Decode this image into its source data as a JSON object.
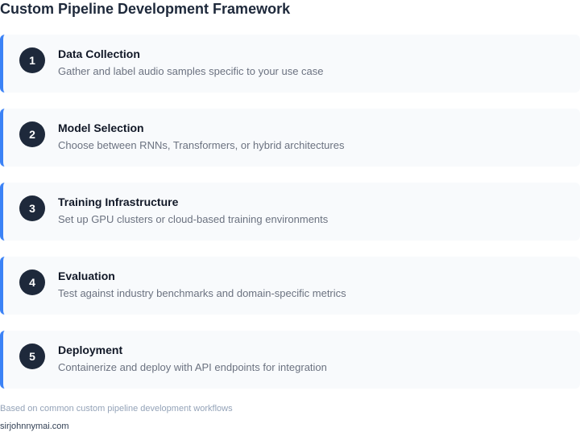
{
  "page": {
    "title": "Custom Pipeline Development Framework"
  },
  "steps": [
    {
      "number": "1",
      "title": "Data Collection",
      "description": "Gather and label audio samples specific to your use case"
    },
    {
      "number": "2",
      "title": "Model Selection",
      "description": "Choose between RNNs, Transformers, or hybrid architectures"
    },
    {
      "number": "3",
      "title": "Training Infrastructure",
      "description": "Set up GPU clusters or cloud-based training environments"
    },
    {
      "number": "4",
      "title": "Evaluation",
      "description": "Test against industry benchmarks and domain-specific metrics"
    },
    {
      "number": "5",
      "title": "Deployment",
      "description": "Containerize and deploy with API endpoints for integration"
    }
  ],
  "footer": {
    "source": "Based on common custom pipeline development workflows",
    "site": "sirjohnnymai.com"
  },
  "colors": {
    "accent": "#3b82f6",
    "badge": "#1e293b",
    "card_background": "#f8fafc"
  }
}
